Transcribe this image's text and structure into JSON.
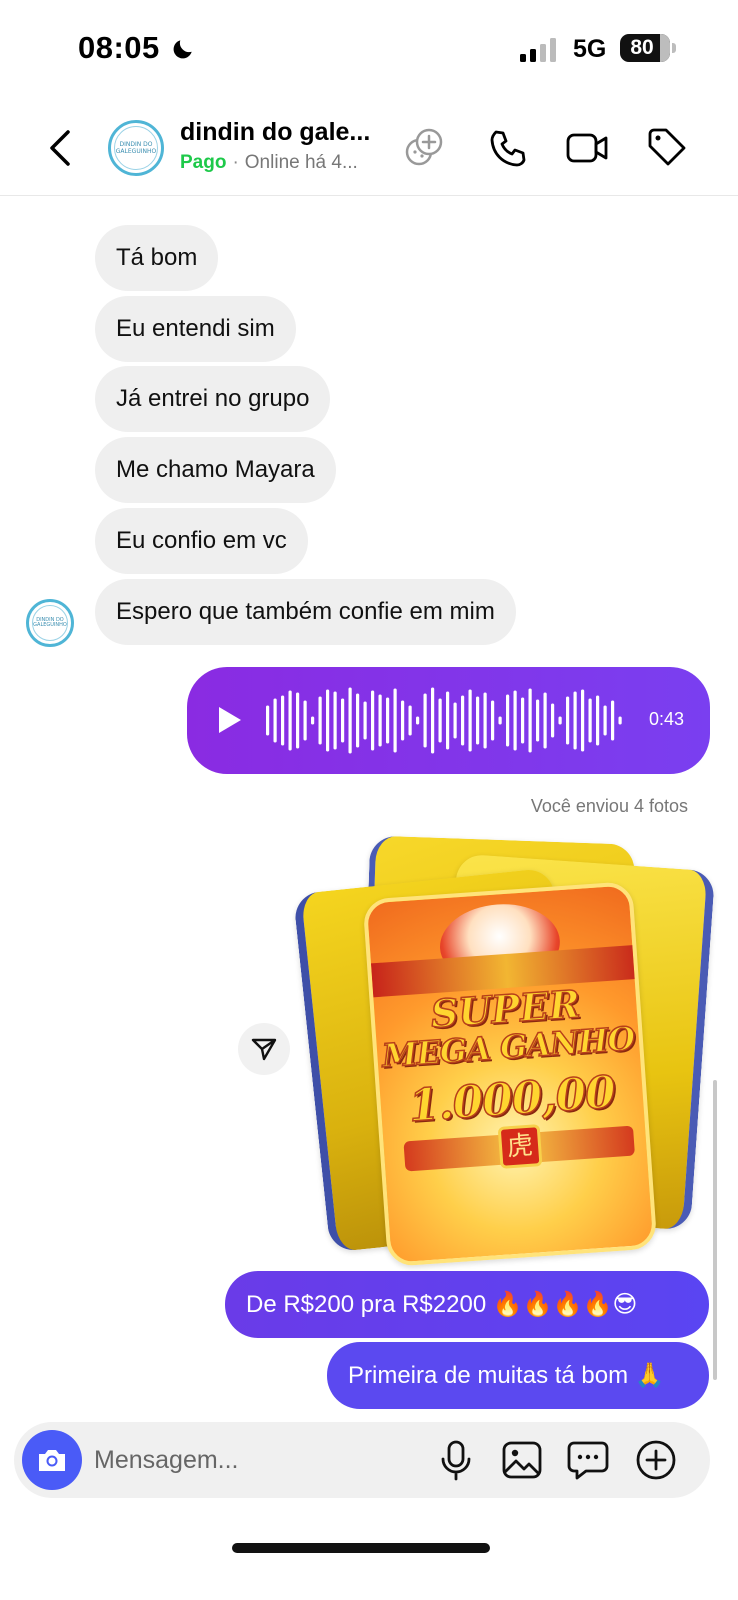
{
  "status_bar": {
    "time": "08:05",
    "network": "5G",
    "battery": "80"
  },
  "header": {
    "contact_name": "dindin do gale...",
    "avatar_text": "DINDIN DO GALEGUINHO",
    "payment_status": "Pago",
    "online_status": "Online há 4..."
  },
  "messages_in": [
    {
      "text": "Tá bom"
    },
    {
      "text": "Eu entendi sim"
    },
    {
      "text": "Já entrei no grupo"
    },
    {
      "text": "Me chamo Mayara"
    },
    {
      "text": "Eu confio em vc"
    },
    {
      "text": "Espero que também confie em mim"
    }
  ],
  "audio_message": {
    "duration": "0:43"
  },
  "photos": {
    "label": "Você enviou 4 fotos",
    "line1": "SUPER",
    "line2": "MEGA GANHO",
    "amount": "1.000,00",
    "seal": "虎"
  },
  "messages_out": [
    {
      "text": "De R$200 pra R$2200 🔥🔥🔥🔥😎"
    },
    {
      "text": "Primeira de muitas tá bom 🙏"
    }
  ],
  "composer": {
    "placeholder": "Mensagem..."
  },
  "colors": {
    "accent": "#5b49f0",
    "audio_bubble": "#7a3ff0",
    "paid_green": "#1ec94a",
    "incoming_bubble": "#efefef"
  }
}
